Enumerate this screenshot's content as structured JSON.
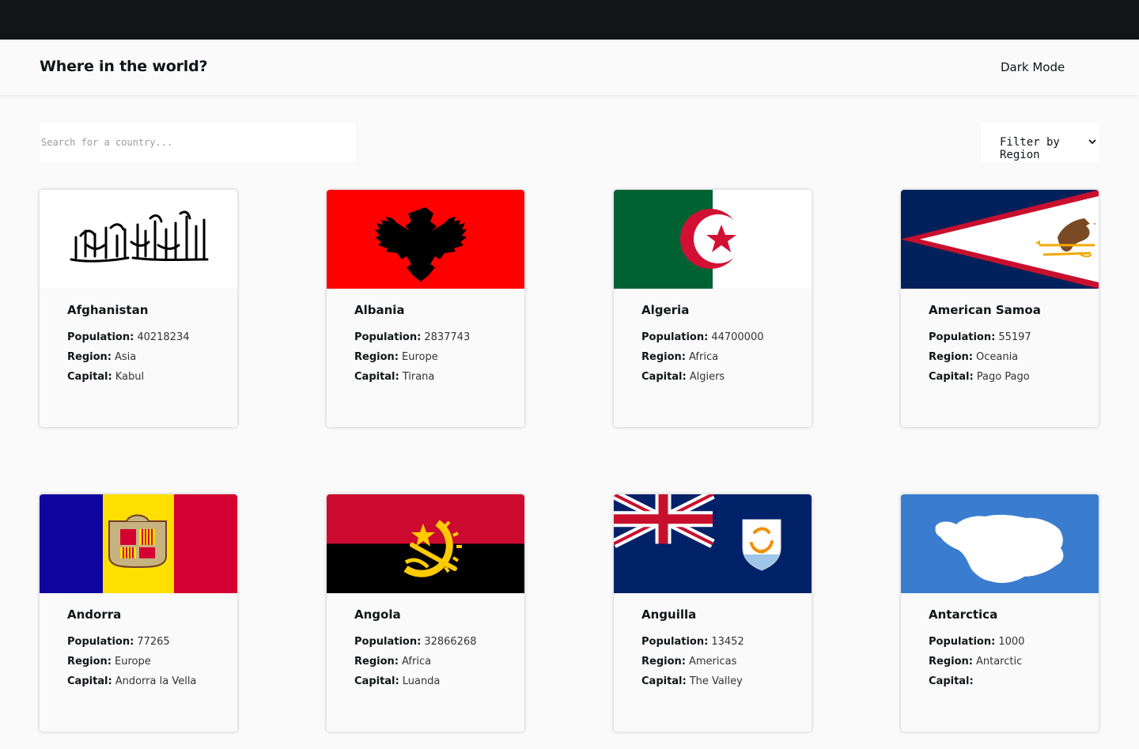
{
  "header": {
    "title": "Where in the world?",
    "mode_label": "Dark Mode"
  },
  "search": {
    "placeholder": "Search for a country..."
  },
  "filter": {
    "label": "Filter by Region"
  },
  "labels": {
    "population": "Population:",
    "region": "Region:",
    "capital": "Capital:"
  },
  "countries": [
    {
      "name": "Afghanistan",
      "population": "40218234",
      "region": "Asia",
      "capital": "Kabul",
      "flag": "afghanistan-flag"
    },
    {
      "name": "Albania",
      "population": "2837743",
      "region": "Europe",
      "capital": "Tirana",
      "flag": "albania-flag"
    },
    {
      "name": "Algeria",
      "population": "44700000",
      "region": "Africa",
      "capital": "Algiers",
      "flag": "algeria-flag"
    },
    {
      "name": "American Samoa",
      "population": "55197",
      "region": "Oceania",
      "capital": "Pago Pago",
      "flag": "american-samoa-flag"
    },
    {
      "name": "Andorra",
      "population": "77265",
      "region": "Europe",
      "capital": "Andorra la Vella",
      "flag": "andorra-flag"
    },
    {
      "name": "Angola",
      "population": "32866268",
      "region": "Africa",
      "capital": "Luanda",
      "flag": "angola-flag"
    },
    {
      "name": "Anguilla",
      "population": "13452",
      "region": "Americas",
      "capital": "The Valley",
      "flag": "anguilla-flag"
    },
    {
      "name": "Antarctica",
      "population": "1000",
      "region": "Antarctic",
      "capital": "",
      "flag": "antarctica-flag"
    }
  ]
}
